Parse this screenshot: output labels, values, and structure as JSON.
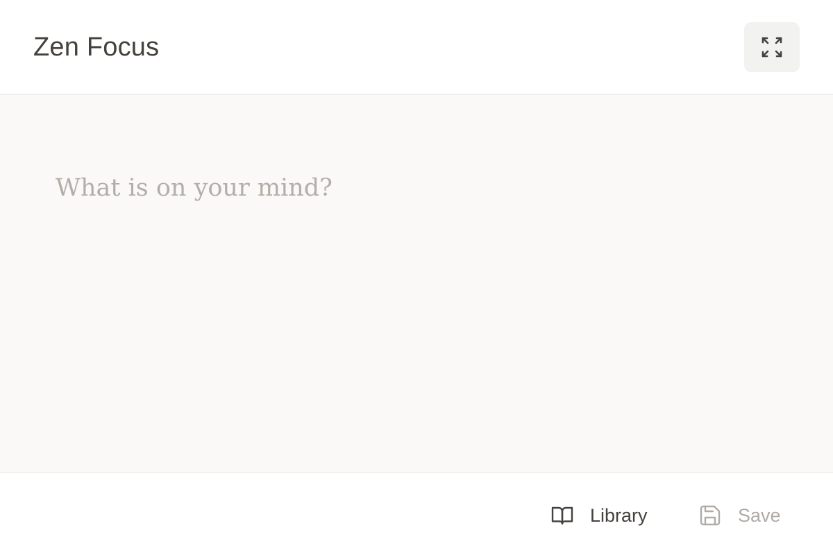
{
  "header": {
    "title": "Zen Focus",
    "fullscreen_icon": "expand-icon"
  },
  "editor": {
    "placeholder": "What is on your mind?",
    "value": ""
  },
  "footer": {
    "library_label": "Library",
    "library_icon": "book-open-icon",
    "save_label": "Save",
    "save_icon": "floppy-disk-icon",
    "save_enabled": false
  },
  "colors": {
    "title_text": "#45413d",
    "editor_background": "#faf9f8",
    "placeholder_text": "#b4aea8",
    "disabled_text": "#b0aba6",
    "button_background": "#f2f2f1"
  }
}
